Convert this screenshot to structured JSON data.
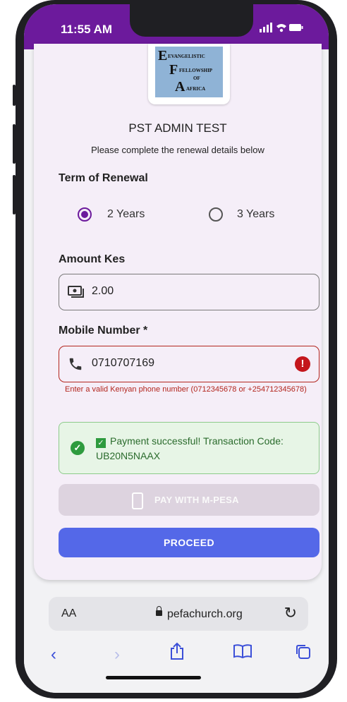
{
  "status_bar": {
    "time": "11:55 AM",
    "indicators": "signal-wifi-battery"
  },
  "logo": {
    "lines": [
      "EVANGELISTIC",
      "FELLOWSHIP",
      "OF",
      "AFRICA"
    ],
    "initials": [
      "E",
      "F",
      "A"
    ]
  },
  "form": {
    "title": "PST ADMIN TEST",
    "subtitle": "Please complete the renewal details below",
    "term_label": "Term of Renewal",
    "term_options": [
      {
        "label": "2 Years",
        "selected": true
      },
      {
        "label": "3 Years",
        "selected": false
      }
    ],
    "amount_label": "Amount Kes",
    "amount_value": "2.00",
    "mobile_label": "Mobile Number *",
    "mobile_value": "0710707169",
    "mobile_error": "Enter a valid Kenyan phone number (0712345678 or +254712345678)",
    "success_message": "Payment successful! Transaction Code: UB20N5NAAX",
    "mpesa_button": "PAY WITH M-PESA",
    "proceed_button": "PROCEED"
  },
  "browser": {
    "text_size_label": "AA",
    "url": "pefachurch.org"
  },
  "colors": {
    "status_bar": "#6c1a9c",
    "radio_accent": "#6c1a9c",
    "proceed": "#5468e8",
    "error": "#b3261e",
    "success_bg": "#e7f5e6",
    "nav_icons": "#3b4fd8"
  }
}
